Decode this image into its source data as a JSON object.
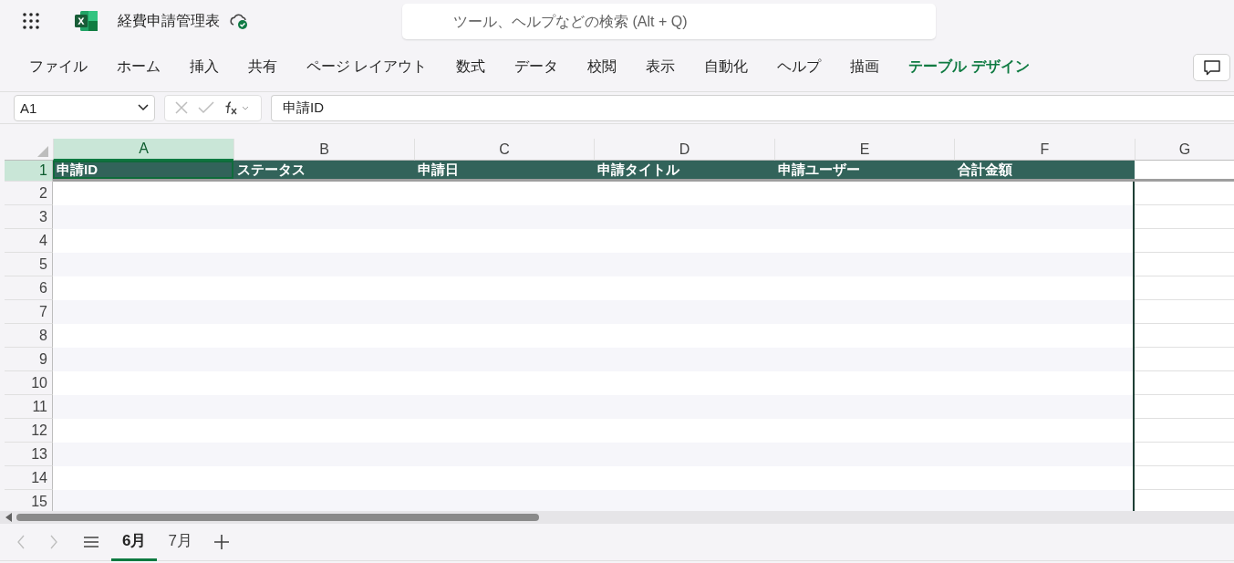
{
  "app": {
    "title": "経費申請管理表",
    "synced": true,
    "search": {
      "placeholder": "ツール、ヘルプなどの検索 (Alt + Q)"
    }
  },
  "ribbon": {
    "tabs": [
      {
        "label": "ファイル",
        "kind": "standard"
      },
      {
        "label": "ホーム",
        "kind": "standard"
      },
      {
        "label": "挿入",
        "kind": "standard"
      },
      {
        "label": "共有",
        "kind": "standard"
      },
      {
        "label": "ページ レイアウト",
        "kind": "standard"
      },
      {
        "label": "数式",
        "kind": "standard"
      },
      {
        "label": "データ",
        "kind": "standard"
      },
      {
        "label": "校閲",
        "kind": "standard"
      },
      {
        "label": "表示",
        "kind": "standard"
      },
      {
        "label": "自動化",
        "kind": "standard"
      },
      {
        "label": "ヘルプ",
        "kind": "standard"
      },
      {
        "label": "描画",
        "kind": "standard"
      },
      {
        "label": "テーブル デザイン",
        "kind": "contextual"
      }
    ]
  },
  "formula_bar": {
    "name_box": "A1",
    "formula": "申請ID"
  },
  "sheet": {
    "columns": [
      {
        "label": "A",
        "selected": true
      },
      {
        "label": "B",
        "selected": false
      },
      {
        "label": "C",
        "selected": false
      },
      {
        "label": "D",
        "selected": false
      },
      {
        "label": "E",
        "selected": false
      },
      {
        "label": "F",
        "selected": false
      },
      {
        "label": "G",
        "selected": false
      }
    ],
    "rows": [
      {
        "number": "1",
        "selected": true,
        "kind": "header",
        "cells": [
          "申請ID",
          "ステータス",
          "申請日",
          "申請タイトル",
          "申請ユーザー",
          "合計金額"
        ]
      },
      {
        "number": "2",
        "selected": false,
        "kind": "data"
      },
      {
        "number": "3",
        "selected": false,
        "kind": "data"
      },
      {
        "number": "4",
        "selected": false,
        "kind": "data"
      },
      {
        "number": "5",
        "selected": false,
        "kind": "data"
      },
      {
        "number": "6",
        "selected": false,
        "kind": "data"
      },
      {
        "number": "7",
        "selected": false,
        "kind": "data"
      },
      {
        "number": "8",
        "selected": false,
        "kind": "data"
      },
      {
        "number": "9",
        "selected": false,
        "kind": "data"
      },
      {
        "number": "10",
        "selected": false,
        "kind": "data"
      },
      {
        "number": "11",
        "selected": false,
        "kind": "data"
      },
      {
        "number": "12",
        "selected": false,
        "kind": "data"
      },
      {
        "number": "13",
        "selected": false,
        "kind": "data"
      },
      {
        "number": "14",
        "selected": false,
        "kind": "data"
      },
      {
        "number": "15",
        "selected": false,
        "kind": "data"
      }
    ]
  },
  "sheet_tabs": [
    {
      "label": "6月",
      "selected": true
    },
    {
      "label": "7月",
      "selected": false
    }
  ]
}
